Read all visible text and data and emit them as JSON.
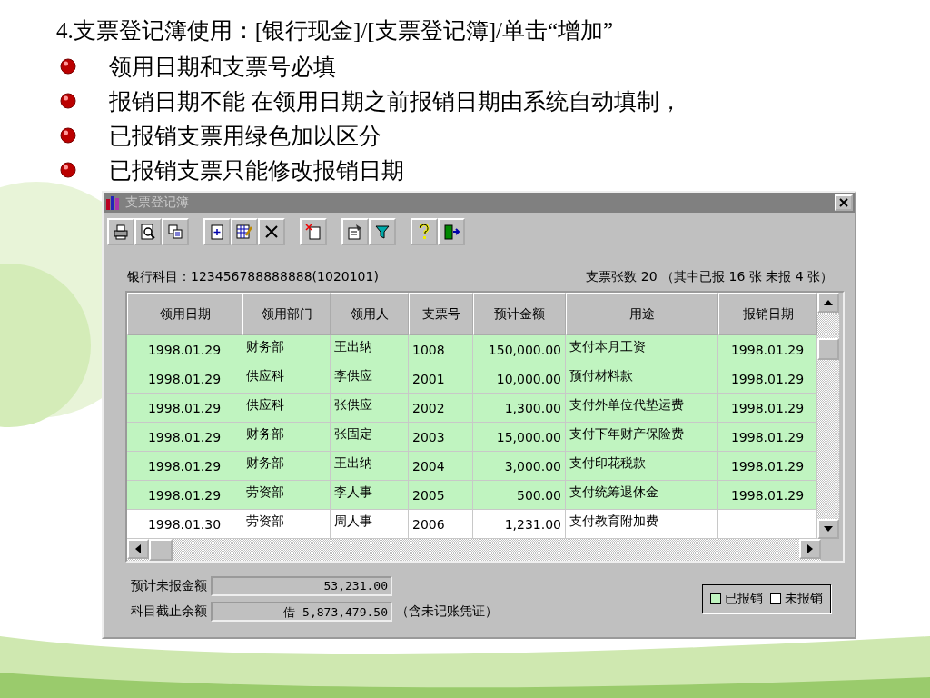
{
  "slide": {
    "title": "4.支票登记簿使用：[银行现金]/[支票登记簿]/单击“增加”",
    "bullets": [
      "领用日期和支票号必填",
      "报销日期不能 在领用日期之前报销日期由系统自动填制，",
      "已报销支票用绿色加以区分",
      "已报销支票只能修改报销日期"
    ]
  },
  "window": {
    "title": "支票登记簿",
    "toolbar_groups": [
      [
        {
          "kind": "print"
        },
        {
          "kind": "preview"
        },
        {
          "kind": "output"
        }
      ],
      [
        {
          "kind": "add"
        },
        {
          "kind": "edit"
        },
        {
          "kind": "delete"
        }
      ],
      [
        {
          "kind": "cancel"
        }
      ],
      [
        {
          "kind": "settings"
        },
        {
          "kind": "filter"
        }
      ],
      [
        {
          "kind": "help"
        },
        {
          "kind": "exit"
        }
      ]
    ],
    "account_label": "银行科目：",
    "account_value": "123456788888888(1020101)",
    "counts": "支票张数 20 （其中已报 16 张 未报 4  张）",
    "table": {
      "columns": [
        "领用日期",
        "领用部门",
        "领用人",
        "支票号",
        "预计金额",
        "用途",
        "报销日期"
      ],
      "rows": [
        {
          "cells": [
            "1998.01.29",
            "财务部",
            "王出纳",
            "1008",
            "150,000.00",
            "支付本月工资",
            "1998.01.29"
          ],
          "reimbursed": true
        },
        {
          "cells": [
            "1998.01.29",
            "供应科",
            "李供应",
            "2001",
            "10,000.00",
            "预付材料款",
            "1998.01.29"
          ],
          "reimbursed": true
        },
        {
          "cells": [
            "1998.01.29",
            "供应科",
            "张供应",
            "2002",
            "1,300.00",
            "支付外单位代垫运费",
            "1998.01.29"
          ],
          "reimbursed": true
        },
        {
          "cells": [
            "1998.01.29",
            "财务部",
            "张固定",
            "2003",
            "15,000.00",
            "支付下年财产保险费",
            "1998.01.29"
          ],
          "reimbursed": true
        },
        {
          "cells": [
            "1998.01.29",
            "财务部",
            "王出纳",
            "2004",
            "3,000.00",
            "支付印花税款",
            "1998.01.29"
          ],
          "reimbursed": true
        },
        {
          "cells": [
            "1998.01.29",
            "劳资部",
            "李人事",
            "2005",
            "500.00",
            "支付统筹退休金",
            "1998.01.29"
          ],
          "reimbursed": true
        },
        {
          "cells": [
            "1998.01.30",
            "劳资部",
            "周人事",
            "2006",
            "1,231.00",
            "支付教育附加费",
            ""
          ],
          "reimbursed": false
        }
      ]
    },
    "summary": [
      {
        "label": "预计未报金额",
        "value": "53,231.00"
      },
      {
        "label": "科目截止余额",
        "value": "借 5,873,479.50",
        "note": "（含未记账凭证）"
      }
    ],
    "legend": [
      {
        "label": "已报销",
        "color": "#c0f4c0"
      },
      {
        "label": "未报销",
        "color": "#ffffff"
      }
    ]
  }
}
